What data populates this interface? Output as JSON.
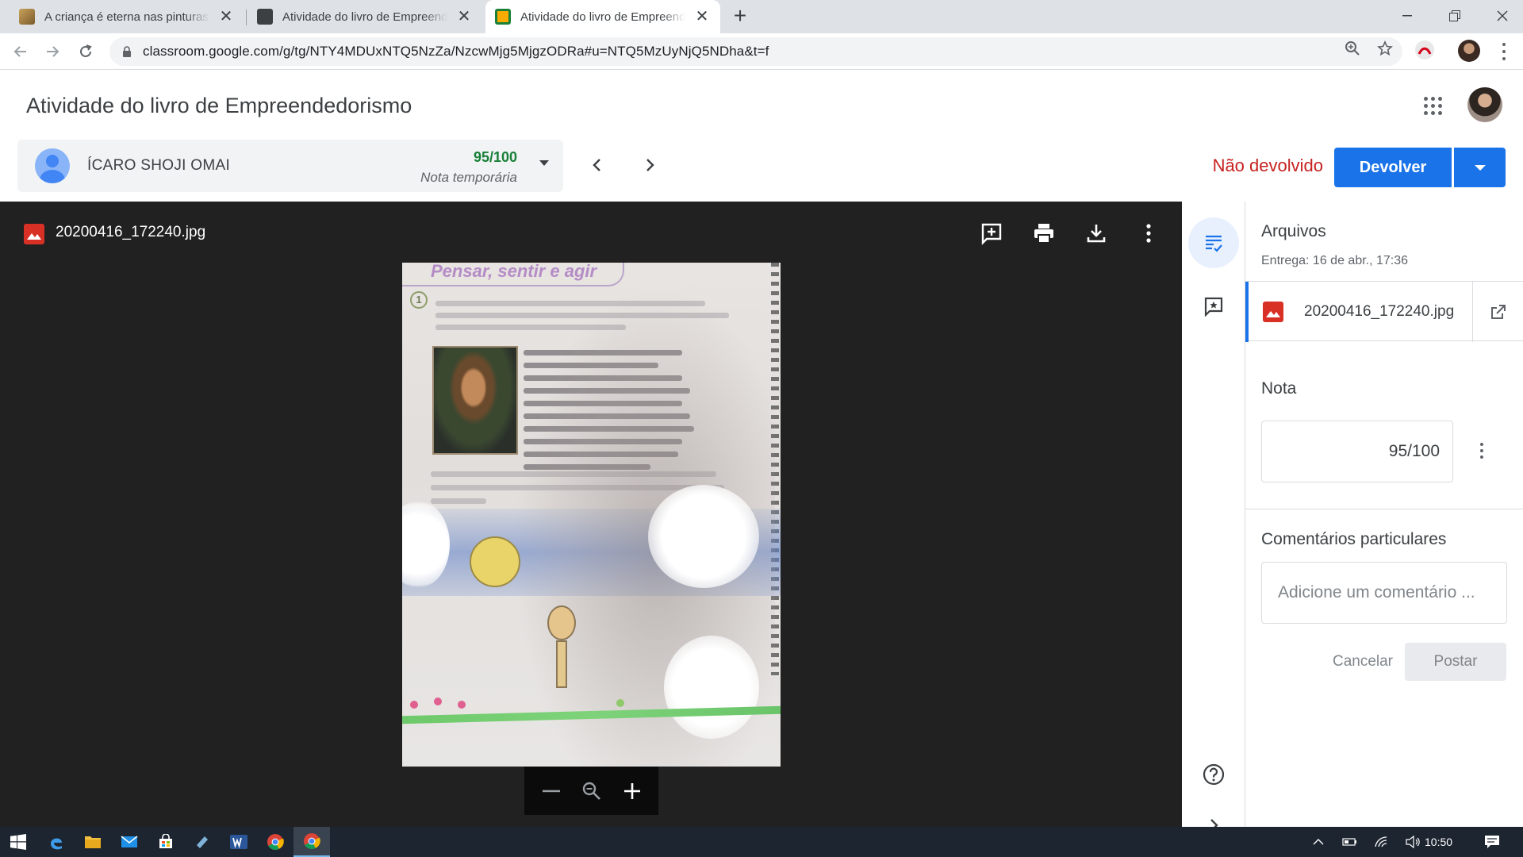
{
  "browser": {
    "tabs": [
      {
        "title": "A criança é eterna nas pinturas de",
        "active": false
      },
      {
        "title": "Atividade do livro de Empreendedorismo",
        "active": false
      },
      {
        "title": "Atividade do livro de Empreendedorismo",
        "active": true
      }
    ],
    "url": "classroom.google.com/g/tg/NTY4MDUxNTQ5NzZa/NzcwMjg5MjgzODRa#u=NTQ5MzUyNjQ5NDha&t=f",
    "close_glyph": "✕",
    "new_tab_glyph": "+"
  },
  "header": {
    "title": "Atividade do livro de Empreendedorismo"
  },
  "student": {
    "name": "ÍCARO SHOJI OMAI",
    "grade": "95/100",
    "grade_status": "Nota temporária"
  },
  "actions": {
    "status": "Não devolvido",
    "return_label": "Devolver"
  },
  "viewer": {
    "file_name": "20200416_172240.jpg",
    "photo_header": "Pensar, sentir e agir",
    "photo_item_number": "1"
  },
  "panel": {
    "files_heading": "Arquivos",
    "submitted": "Entrega: 16 de abr., 17:36",
    "attachment_name": "20200416_172240.jpg",
    "grade_heading": "Nota",
    "grade_value": "95/100",
    "comments_heading": "Comentários particulares",
    "comment_placeholder": "Adicione um comentário ...",
    "cancel_label": "Cancelar",
    "post_label": "Postar"
  },
  "taskbar": {
    "time": "10:50"
  },
  "colors": {
    "accent": "#1a73e8",
    "grade_green": "#188038",
    "status_red": "#c5221f",
    "viewer_bg": "#212121"
  },
  "icons": [
    "image-file-icon",
    "add-comment-icon",
    "print-icon",
    "download-icon",
    "more-vert-icon",
    "zoom-out-icon",
    "zoom-icon",
    "zoom-in-icon",
    "open-in-new-icon",
    "rubric-icon",
    "comment-icon",
    "help-icon",
    "chevron-right-icon",
    "apps-grid-icon"
  ]
}
